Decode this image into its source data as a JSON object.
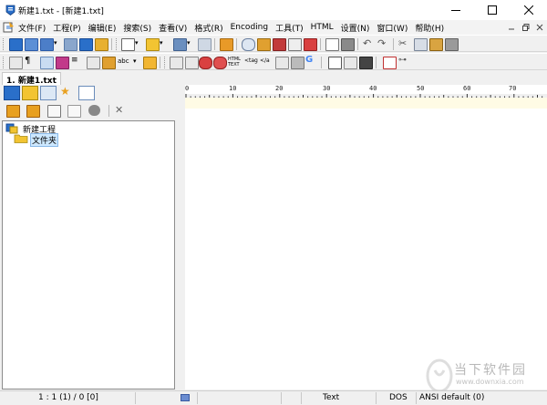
{
  "window": {
    "title": "新建1.txt - [新建1.txt]",
    "controls": [
      "minimize-icon",
      "maximize-icon",
      "close-icon"
    ]
  },
  "menu": {
    "items": [
      "文件(F)",
      "工程(P)",
      "编辑(E)",
      "搜索(S)",
      "查看(V)",
      "格式(R)",
      "Encoding",
      "工具(T)",
      "HTML",
      "设置(N)",
      "窗口(W)",
      "帮助(H)"
    ]
  },
  "tabs": {
    "document": "1. 新建1.txt"
  },
  "project_tree": {
    "root": "新建工程",
    "child": "文件夹"
  },
  "ruler": {
    "labels": [
      "0",
      "10",
      "20",
      "30",
      "40",
      "50",
      "60",
      "70"
    ]
  },
  "status": {
    "position": "1 : 1 (1) / 0  [0]",
    "file_type": "Text",
    "line_ending": "DOS",
    "encoding": "ANSI default (0)"
  },
  "watermark": {
    "text": "当下软件园",
    "url": "www.downxia.com"
  },
  "colors": {
    "accent_blue": "#2a6fc9",
    "folder_yellow": "#f2c432",
    "current_line": "#fffbe5",
    "selection": "#cde8ff"
  }
}
